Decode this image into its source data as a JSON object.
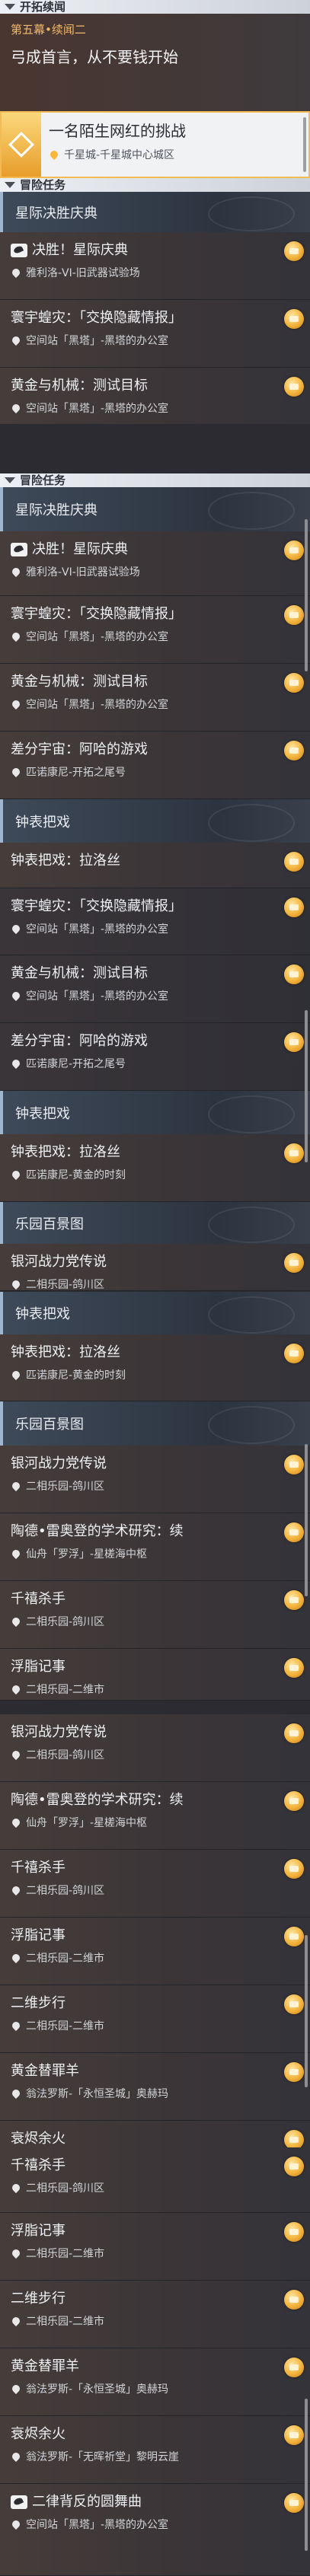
{
  "main": {
    "category": "开拓续闻",
    "chapter": "第五幕•续闻二",
    "title": "弓成首言，从不要钱开始",
    "active": {
      "title": "一名陌生网红的挑战",
      "location": "千星城-千星城中心城区"
    }
  },
  "adventure_category": "冒险任务",
  "groups": {
    "g1": "星际决胜庆典",
    "g2": "钟表把戏",
    "g3": "乐园百景图"
  },
  "quests": {
    "duel": {
      "title": "决胜！星际庆典",
      "location": "雅利洛-VI-旧武器试验场"
    },
    "locust": {
      "title": "寰宇蝗灾：「交换隐藏情报」",
      "location": "空间站「黑塔」-黑塔的办公室"
    },
    "gold": {
      "title": "黄金与机械：测试目标",
      "location": "空间站「黑塔」-黑塔的办公室"
    },
    "diff": {
      "title": "差分宇宙：阿哈的游戏",
      "location": "匹诺康尼-开拓之尾号"
    },
    "clock": {
      "title": "钟表把戏：拉洛丝",
      "location": "匹诺康尼-黄金的时刻"
    },
    "galaxy": {
      "title": "银河战力党传说",
      "location": "二相乐园-鸽川区"
    },
    "tao": {
      "title": "陶德•雷奥登的学术研究：续",
      "location": "仙舟「罗浮」-星槎海中枢"
    },
    "qian": {
      "title": "千禧杀手",
      "location": "二相乐园-鸽川区"
    },
    "fu": {
      "title": "浮脂记事",
      "location": "二相乐园-二维市"
    },
    "erwei": {
      "title": "二维步行",
      "location": "二相乐园-二维市"
    },
    "ram": {
      "title": "黄金替罪羊",
      "location": "翁法罗斯-「永恒圣城」奥赫玛"
    },
    "ember": {
      "title": "衰烬余火",
      "location": "翁法罗斯-「无晖祈堂」黎明云崖"
    },
    "ballad": {
      "title": "二律背反的圆舞曲",
      "location": "空间站「黑塔」-黑塔的办公室"
    }
  }
}
